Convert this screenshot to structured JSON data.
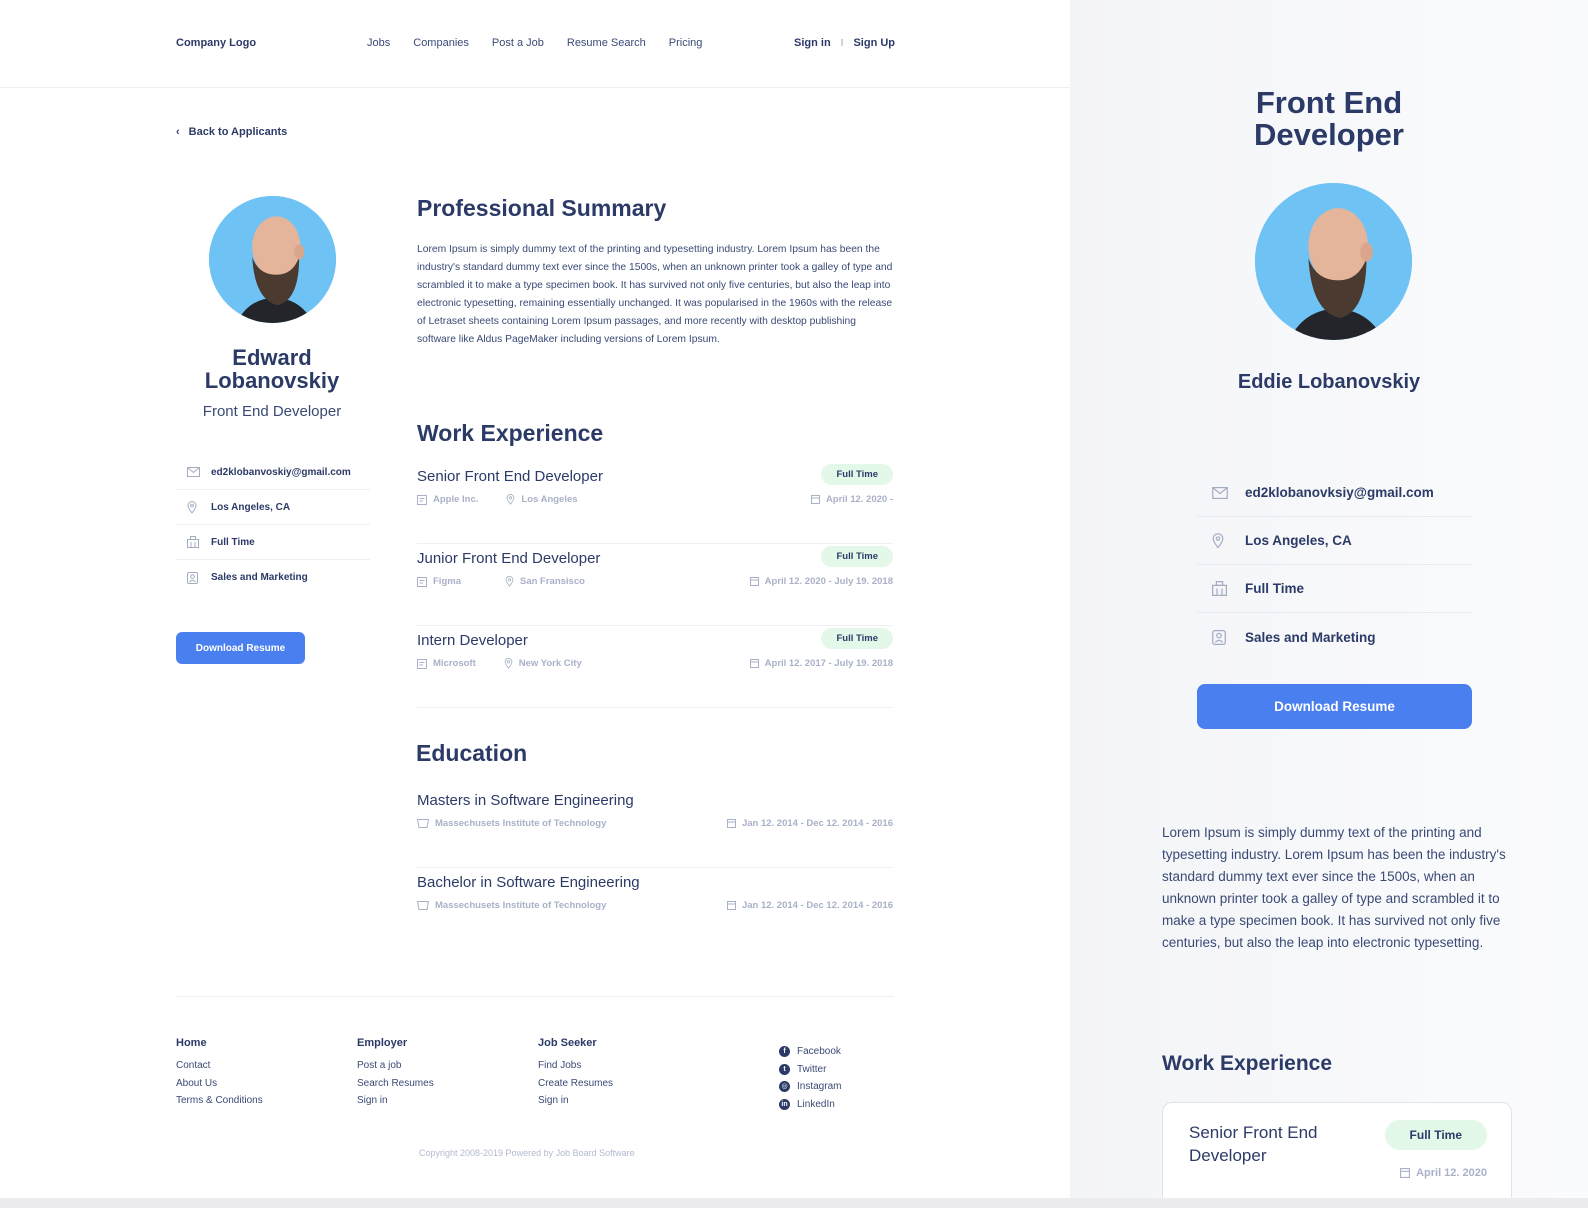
{
  "header": {
    "logo": "Company Logo",
    "nav": [
      "Jobs",
      "Companies",
      "Post a Job",
      "Resume Search",
      "Pricing"
    ],
    "sign_in": "Sign in",
    "separator": "I",
    "sign_up": "Sign Up"
  },
  "back_label": "Back to Applicants",
  "profile": {
    "first_name": "Edward",
    "last_name": "Lobanovskiy",
    "title": "Front End Developer",
    "email": "ed2klobanvoskiy@gmail.com",
    "location": "Los Angeles, CA",
    "employment": "Full Time",
    "department": "Sales and Marketing",
    "download_label": "Download Resume"
  },
  "summary": {
    "heading": "Professional Summary",
    "text": "Lorem Ipsum is simply dummy text of the printing and typesetting industry. Lorem Ipsum has been the industry's standard dummy text ever since the 1500s, when an unknown printer took a galley of type and scrambled it to make a type specimen book. It has survived not only five centuries, but also the leap into electronic typesetting, remaining essentially unchanged. It was popularised in the 1960s with the release of Letraset sheets containing Lorem Ipsum passages, and more recently with desktop publishing software like Aldus PageMaker including versions of Lorem Ipsum."
  },
  "work": {
    "heading": "Work Experience",
    "items": [
      {
        "title": "Senior Front End Developer",
        "badge": "Full Time",
        "company": "Apple Inc.",
        "city": "Los Angeles",
        "dates": "April 12. 2020 -"
      },
      {
        "title": "Junior Front End Developer",
        "badge": "Full Time",
        "company": "Figma",
        "city": "San Fransisco",
        "dates": "April 12. 2020 - July 19. 2018"
      },
      {
        "title": "Intern Developer",
        "badge": "Full Time",
        "company": "Microsoft",
        "city": "New York City",
        "dates": "April 12. 2017 - July 19. 2018"
      }
    ]
  },
  "education": {
    "heading": "Education",
    "items": [
      {
        "title": "Masters in Software Engineering",
        "school": "Massechusets Institute of Technology",
        "dates": "Jan 12. 2014 - Dec 12. 2014 - 2016"
      },
      {
        "title": "Bachelor in Software Engineering",
        "school": "Massechusets Institute of Technology",
        "dates": "Jan 12. 2014 - Dec 12. 2014 - 2016"
      }
    ]
  },
  "footer": {
    "cols": [
      {
        "heading": "Home",
        "links": [
          "Contact",
          "About Us",
          "Terms & Conditions"
        ]
      },
      {
        "heading": "Employer",
        "links": [
          "Post a job",
          "Search Resumes",
          "Sign in"
        ]
      },
      {
        "heading": "Job Seeker",
        "links": [
          "Find Jobs",
          "Create Resumes",
          "Sign in"
        ]
      }
    ],
    "social": [
      "Facebook",
      "Twitter",
      "Instagram",
      "LinkedIn"
    ],
    "copyright": "Copyright 2008-2019 Powered by Job Board Software"
  },
  "mobile": {
    "title_line1": "Front End",
    "title_line2": "Developer",
    "name": "Eddie Lobanovskiy",
    "email": "ed2klobanovksiy@gmail.com",
    "location": "Los Angeles, CA",
    "employment": "Full Time",
    "department": "Sales and Marketing",
    "download_label": "Download Resume",
    "summary": "Lorem Ipsum is simply dummy text of the printing and typesetting industry. Lorem Ipsum has been the industry's standard dummy text ever since the 1500s, when an unknown printer took a galley of type and scrambled it to make a type specimen book. It has survived not only five centuries, but also the leap into electronic typesetting.",
    "work_heading": "Work Experience",
    "card": {
      "title": "Senior Front End Developer",
      "badge": "Full Time",
      "dates": "April 12. 2020"
    }
  },
  "colors": {
    "accent": "#4a7ff0",
    "navy": "#2b3a67",
    "badge_bg": "#e3f8e9",
    "avatar_bg": "#6ec3f4"
  }
}
